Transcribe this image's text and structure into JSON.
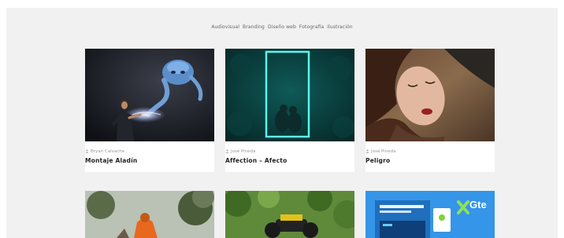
{
  "filters": {
    "items": [
      "Audiovisual",
      "Branding",
      "Diseño web",
      "Fotografía",
      "Ilustración"
    ]
  },
  "cards": [
    {
      "author": "Bryan Calvache",
      "title": "Montaje Aladín"
    },
    {
      "author": "José Pineda",
      "title": "Affection – Afecto"
    },
    {
      "author": "José Pineda",
      "title": "Peligro"
    }
  ],
  "bottom_cards": [
    {
      "image": "person-in-orange-jacket-forest"
    },
    {
      "image": "motorcycle-in-jungle"
    },
    {
      "image": "gte-website-mockup",
      "logo_text": "Gte"
    }
  ],
  "colors": {
    "panel_bg": "#f1f1f1",
    "card_bg": "#ffffff",
    "author_text": "#9a9a9a",
    "title_text": "#222222",
    "gte_blue": "#2f8ee0"
  }
}
